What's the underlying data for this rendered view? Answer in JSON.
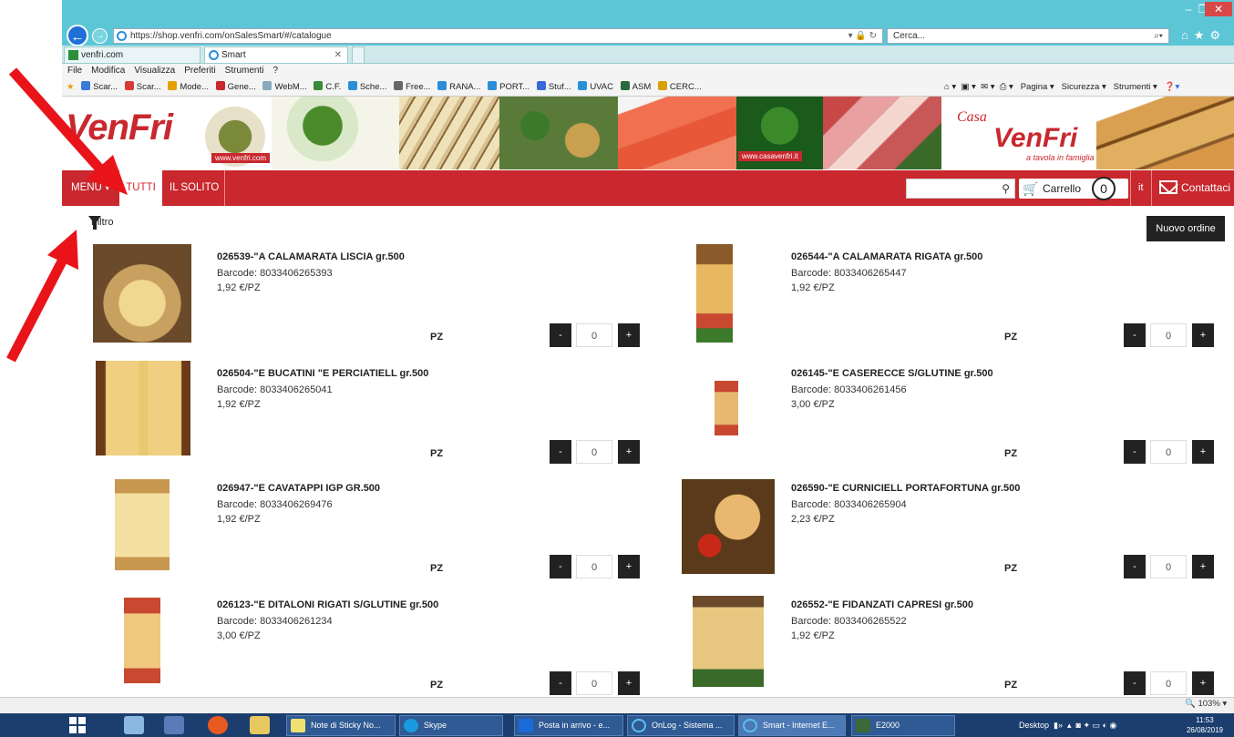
{
  "browser": {
    "url": "https://shop.venfri.com/onSalesSmart/#/catalogue",
    "search_placeholder": "Cerca...",
    "tabs": [
      {
        "label": "venfri.com"
      },
      {
        "label": "Smart"
      }
    ],
    "menu": [
      "File",
      "Modifica",
      "Visualizza",
      "Preferiti",
      "Strumenti",
      "?"
    ],
    "favorites": [
      "Scar...",
      "Scar...",
      "Mode...",
      "Gene...",
      "WebM...",
      "C.F.",
      "Sche...",
      "Free...",
      "RANA...",
      "PORT...",
      "Stuf...",
      "UVAC",
      "ASM",
      "CERC..."
    ],
    "command_bar": [
      "Pagina ▾",
      "Sicurezza ▾",
      "Strumenti ▾"
    ]
  },
  "site": {
    "logo": "VenFri",
    "banner_tag1": "www.venfri.com",
    "banner_tag2": "www.casavenfri.it",
    "logo2_casa": "Casa",
    "logo2_name": "VenFri",
    "logo2_tagline": "a tavola in famiglia",
    "nav": {
      "menu": "MENU ▾",
      "tutti": "TUTTI",
      "solito": "IL SOLITO",
      "cart_label": "Carrello",
      "cart_count": "0",
      "lang": "it",
      "contact": "Contattaci"
    },
    "filter_label": "Filtro",
    "new_order": "Nuovo ordine"
  },
  "products": [
    {
      "name": "026539-\"A CALAMARATA LISCIA gr.500",
      "barcode": "Barcode: 8033406265393",
      "price": "1,92 €/PZ",
      "unit": "PZ",
      "qty": "0"
    },
    {
      "name": "026544-\"A CALAMARATA RIGATA gr.500",
      "barcode": "Barcode: 8033406265447",
      "price": "1,92 €/PZ",
      "unit": "PZ",
      "qty": "0"
    },
    {
      "name": "026504-\"E BUCATINI \"E PERCIATIELL gr.500",
      "barcode": "Barcode: 8033406265041",
      "price": "1,92 €/PZ",
      "unit": "PZ",
      "qty": "0"
    },
    {
      "name": "026145-\"E CASERECCE S/GLUTINE gr.500",
      "barcode": "Barcode: 8033406261456",
      "price": "3,00 €/PZ",
      "unit": "PZ",
      "qty": "0"
    },
    {
      "name": "026947-\"E CAVATAPPI IGP GR.500",
      "barcode": "Barcode: 8033406269476",
      "price": "1,92 €/PZ",
      "unit": "PZ",
      "qty": "0"
    },
    {
      "name": "026590-\"E CURNICIELL PORTAFORTUNA gr.500",
      "barcode": "Barcode: 8033406265904",
      "price": "2,23 €/PZ",
      "unit": "PZ",
      "qty": "0"
    },
    {
      "name": "026123-\"E DITALONI RIGATI S/GLUTINE gr.500",
      "barcode": "Barcode: 8033406261234",
      "price": "3,00 €/PZ",
      "unit": "PZ",
      "qty": "0"
    },
    {
      "name": "026552-\"E FIDANZATI CAPRESI gr.500",
      "barcode": "Barcode: 8033406265522",
      "price": "1,92 €/PZ",
      "unit": "PZ",
      "qty": "0"
    }
  ],
  "qty_minus": "-",
  "qty_plus": "+",
  "statusbar": {
    "zoom": "103%"
  },
  "taskbar": {
    "items": [
      "Note di Sticky No...",
      "Skype",
      "Posta in arrivo - e...",
      "OnLog - Sistema ...",
      "Smart - Internet E...",
      "E2000"
    ],
    "tray_label": "Desktop",
    "time": "11:53",
    "date": "26/08/2019"
  }
}
